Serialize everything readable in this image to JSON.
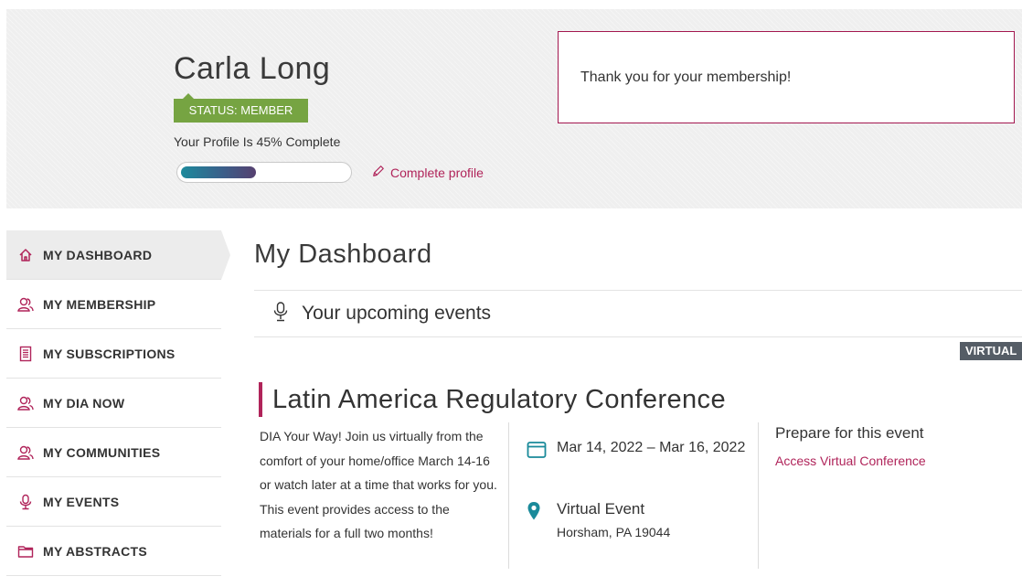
{
  "profile": {
    "name": "Carla Long",
    "status": "STATUS: MEMBER",
    "completion_text": "Your Profile Is 45% Complete",
    "completion_percent": 45,
    "complete_link": "Complete profile"
  },
  "notice": {
    "message": "Thank you for your membership!"
  },
  "sidebar": {
    "items": [
      {
        "label": "MY DASHBOARD",
        "icon": "home-icon",
        "active": true
      },
      {
        "label": "MY MEMBERSHIP",
        "icon": "users-icon",
        "active": false
      },
      {
        "label": "MY SUBSCRIPTIONS",
        "icon": "document-icon",
        "active": false
      },
      {
        "label": "MY DIA NOW",
        "icon": "users-icon",
        "active": false
      },
      {
        "label": "MY COMMUNITIES",
        "icon": "users-icon",
        "active": false
      },
      {
        "label": "MY EVENTS",
        "icon": "microphone-icon",
        "active": false
      },
      {
        "label": "MY ABSTRACTS",
        "icon": "folder-icon",
        "active": false
      }
    ]
  },
  "main": {
    "title": "My Dashboard",
    "events_section": {
      "title": "Your upcoming events",
      "icon": "microphone-icon"
    },
    "event": {
      "badge": "VIRTUAL",
      "title": "Latin America Regulatory Conference",
      "description": "DIA Your Way! Join us virtually from the comfort of your home/office March 14-16 or watch later at a time that works for you. This event provides access to the materials for a full two months!",
      "dates": "Mar 14, 2022 – Mar 16, 2022",
      "location_title": "Virtual Event",
      "location_address": "Horsham, PA 19044",
      "prepare_title": "Prepare for this event",
      "prepare_link": "Access Virtual Conference"
    }
  },
  "colors": {
    "accent": "#b0245a",
    "status_green": "#76a442",
    "badge_gray": "#555d66",
    "icon_teal": "#1a8a9a"
  }
}
